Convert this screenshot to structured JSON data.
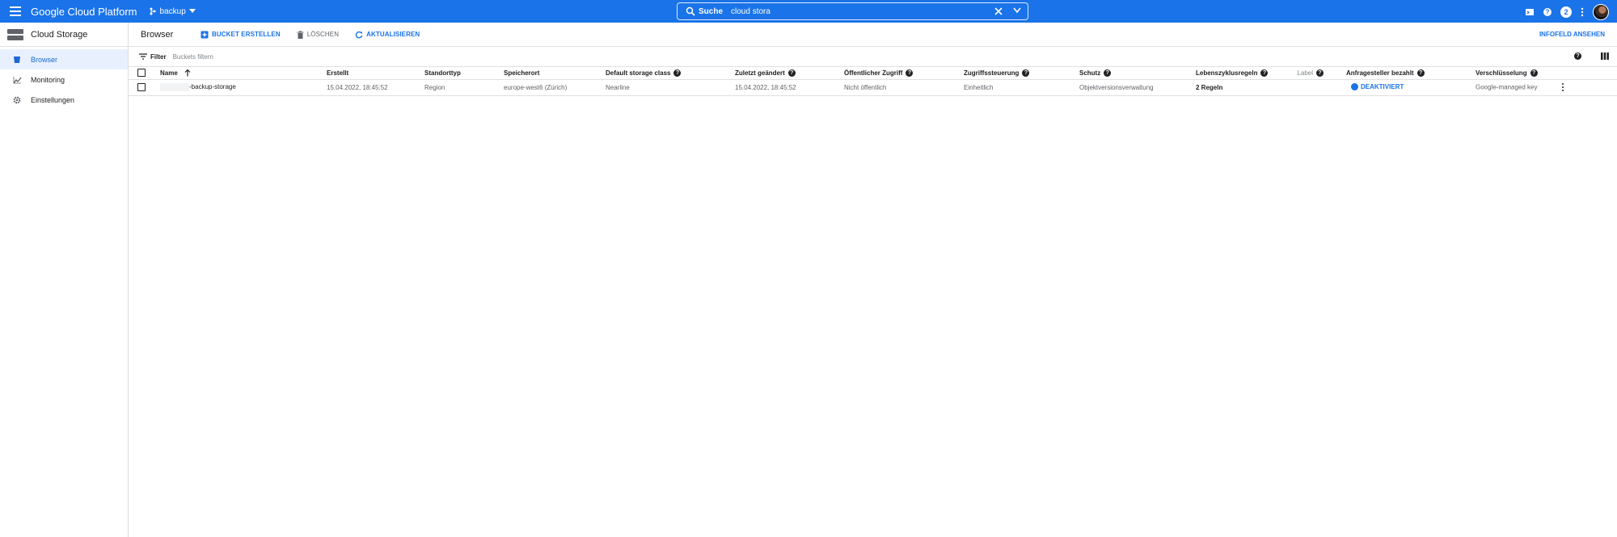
{
  "topbar": {
    "product": "Google Cloud Platform",
    "project": "backup",
    "search_label": "Suche",
    "search_value": "cloud stora",
    "notifications_count": "2",
    "icons": [
      "menu-icon",
      "project-icon",
      "search-icon",
      "clear-icon",
      "chevron-down-icon",
      "terminal-icon",
      "help-icon",
      "more-vert-icon"
    ]
  },
  "sidebar": {
    "title": "Cloud Storage",
    "items": [
      {
        "label": "Browser",
        "icon": "bucket-icon",
        "active": true
      },
      {
        "label": "Monitoring",
        "icon": "chart-icon",
        "active": false
      },
      {
        "label": "Einstellungen",
        "icon": "gear-icon",
        "active": false
      }
    ]
  },
  "toolbar": {
    "title": "Browser",
    "create_label": "BUCKET ERSTELLEN",
    "delete_label": "LÖSCHEN",
    "refresh_label": "AKTUALISIEREN",
    "info_label": "INFOFELD ANSEHEN"
  },
  "filter": {
    "label": "Filter",
    "placeholder": "Buckets filtern"
  },
  "table": {
    "columns": {
      "name": "Name",
      "created": "Erstellt",
      "location_type": "Standorttyp",
      "location": "Speicherort",
      "storage_class": "Default storage class",
      "modified": "Zuletzt geändert",
      "public_access": "Öffentlicher Zugriff",
      "access_control": "Zugriffssteuerung",
      "protection": "Schutz",
      "lifecycle": "Lebenszyklusregeln",
      "label": "Label",
      "requester_pays": "Anfragesteller bezahlt",
      "encryption": "Verschlüsselung"
    },
    "rows": [
      {
        "name": "-backup-storage",
        "created": "15.04.2022, 18:45:52",
        "location_type": "Region",
        "location": "europe-west6 (Zürich)",
        "storage_class": "Nearline",
        "modified": "15.04.2022, 18:45:52",
        "public_access": "Nicht öffentlich",
        "access_control": "Einheitlich",
        "protection": "Objektversionsverwaltung",
        "lifecycle": "2 Regeln",
        "label": "",
        "requester_pays": "DEAKTIVIERT",
        "encryption": "Google-managed key"
      }
    ]
  },
  "colors": {
    "primary": "#1a73e8",
    "active_bg": "#e8f0fe",
    "border": "#e0e0e0"
  }
}
